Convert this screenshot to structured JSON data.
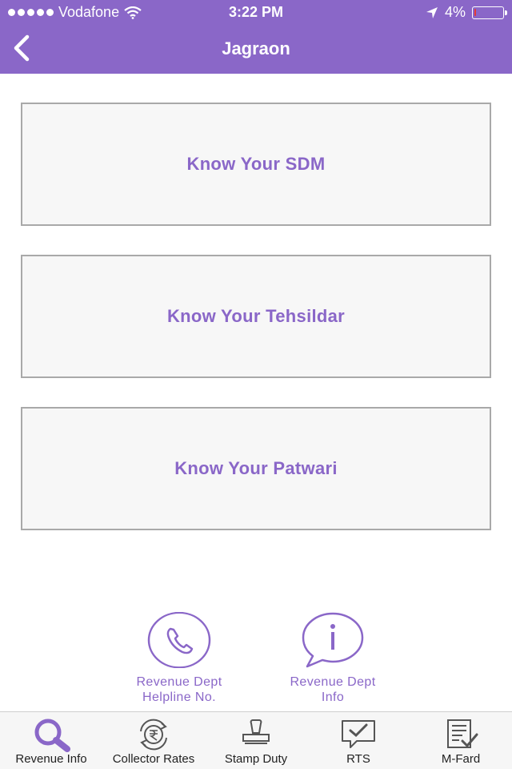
{
  "status_bar": {
    "carrier": "Vodafone",
    "time": "3:22 PM",
    "battery": "4%",
    "battery_level": 0.04
  },
  "nav": {
    "title": "Jagraon"
  },
  "cards": [
    {
      "label": "Know Your SDM"
    },
    {
      "label": "Know Your Tehsildar"
    },
    {
      "label": "Know Your Patwari"
    }
  ],
  "quick_links": {
    "helpline": {
      "line1": "Revenue Dept",
      "line2": "Helpline No."
    },
    "info": {
      "line1": "Revenue Dept",
      "line2": "Info"
    }
  },
  "tabs": [
    {
      "label": "Revenue Info",
      "icon": "magnifier-icon"
    },
    {
      "label": "Collector Rates",
      "icon": "rupee-cycle-icon"
    },
    {
      "label": "Stamp Duty",
      "icon": "stamp-icon"
    },
    {
      "label": "RTS",
      "icon": "chat-check-icon"
    },
    {
      "label": "M-Fard",
      "icon": "document-check-icon"
    }
  ],
  "colors": {
    "accent": "#8a67c8",
    "card_bg": "#f7f7f7",
    "card_border": "#a9a9a9",
    "tabbar_bg": "#f6f6f6"
  }
}
